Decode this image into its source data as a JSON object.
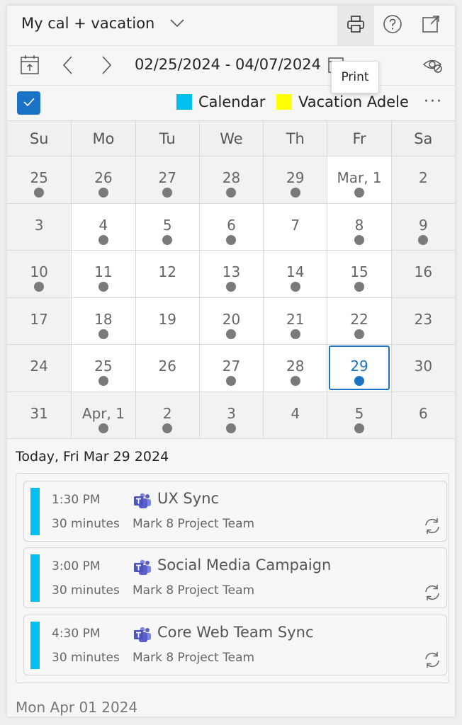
{
  "header": {
    "title": "My cal + vacation",
    "print_tooltip": "Print"
  },
  "navigation": {
    "date_range": "02/25/2024 - 04/07/2024"
  },
  "legend": {
    "items": [
      {
        "label": "Calendar",
        "color": "#03bef0"
      },
      {
        "label": "Vacation Adele",
        "color": "#ffff00"
      }
    ],
    "more": "···"
  },
  "calendar": {
    "weekdays": [
      "Su",
      "Mo",
      "Tu",
      "We",
      "Th",
      "Fr",
      "Sa"
    ],
    "weeks": [
      [
        {
          "label": "25",
          "dot": true
        },
        {
          "label": "26",
          "dot": true
        },
        {
          "label": "27",
          "dot": true
        },
        {
          "label": "28",
          "dot": true
        },
        {
          "label": "29",
          "dot": true
        },
        {
          "label": "Mar, 1",
          "dot": true
        },
        {
          "label": "2",
          "dot": false
        }
      ],
      [
        {
          "label": "3",
          "dot": false
        },
        {
          "label": "4",
          "dot": true
        },
        {
          "label": "5",
          "dot": true
        },
        {
          "label": "6",
          "dot": true
        },
        {
          "label": "7",
          "dot": false
        },
        {
          "label": "8",
          "dot": true
        },
        {
          "label": "9",
          "dot": true
        }
      ],
      [
        {
          "label": "10",
          "dot": true
        },
        {
          "label": "11",
          "dot": true
        },
        {
          "label": "12",
          "dot": false
        },
        {
          "label": "13",
          "dot": true
        },
        {
          "label": "14",
          "dot": true
        },
        {
          "label": "15",
          "dot": true
        },
        {
          "label": "16",
          "dot": false
        }
      ],
      [
        {
          "label": "17",
          "dot": false
        },
        {
          "label": "18",
          "dot": true
        },
        {
          "label": "19",
          "dot": false
        },
        {
          "label": "20",
          "dot": true
        },
        {
          "label": "21",
          "dot": true
        },
        {
          "label": "22",
          "dot": true
        },
        {
          "label": "23",
          "dot": false
        }
      ],
      [
        {
          "label": "24",
          "dot": false
        },
        {
          "label": "25",
          "dot": true
        },
        {
          "label": "26",
          "dot": false
        },
        {
          "label": "27",
          "dot": true
        },
        {
          "label": "28",
          "dot": true
        },
        {
          "label": "29",
          "dot": true,
          "today": true
        },
        {
          "label": "30",
          "dot": false
        }
      ],
      [
        {
          "label": "31",
          "dot": false
        },
        {
          "label": "Apr, 1",
          "dot": true
        },
        {
          "label": "2",
          "dot": true
        },
        {
          "label": "3",
          "dot": true
        },
        {
          "label": "4",
          "dot": false
        },
        {
          "label": "5",
          "dot": true
        },
        {
          "label": "6",
          "dot": false
        }
      ]
    ]
  },
  "agenda": {
    "today_heading": "Today, Fri Mar 29 2024",
    "events": [
      {
        "time": "1:30 PM",
        "duration": "30 minutes",
        "subject": "UX Sync",
        "organizer": "Mark 8 Project Team"
      },
      {
        "time": "3:00 PM",
        "duration": "30 minutes",
        "subject": "Social Media Campaign",
        "organizer": "Mark 8 Project Team"
      },
      {
        "time": "4:30 PM",
        "duration": "30 minutes",
        "subject": "Core Web Team Sync",
        "organizer": "Mark 8 Project Team"
      }
    ],
    "next_heading": "Mon Apr 01 2024"
  }
}
